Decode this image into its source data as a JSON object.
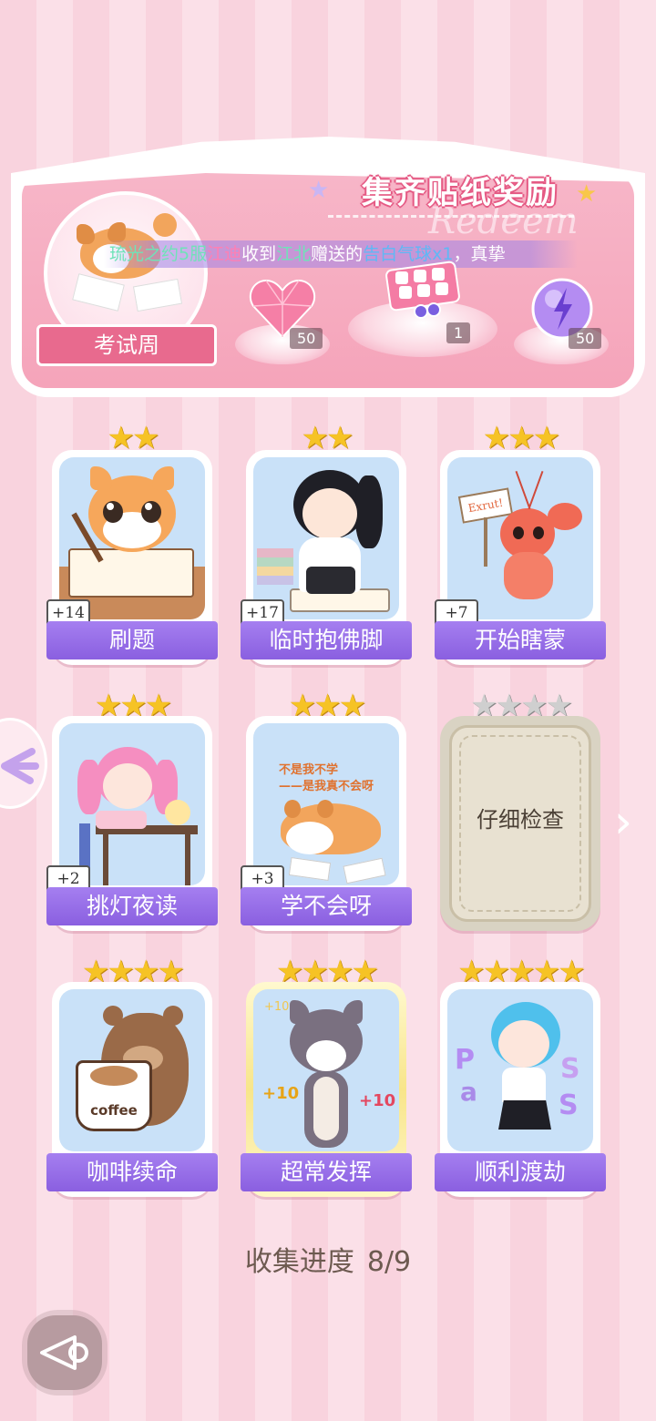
{
  "banner": {
    "title": "集齐贴纸奖励",
    "theme_label": "考试周",
    "marquee": {
      "part1": "琉光之约5服",
      "part2": "江迪",
      "part3": "收到",
      "part4": "江北",
      "part5": "赠送的",
      "part6": "告白气球x1",
      "part7": "，真挚"
    },
    "rewards": [
      {
        "name": "heart-gem",
        "count": "50"
      },
      {
        "name": "gift-box",
        "count": "1"
      },
      {
        "name": "energy-orb",
        "count": "50"
      }
    ]
  },
  "cards": [
    {
      "label": "刷题",
      "count": "+14",
      "stars": "★★",
      "locked": false
    },
    {
      "label": "临时抱佛脚",
      "count": "+17",
      "stars": "★★",
      "locked": false
    },
    {
      "label": "开始瞎蒙",
      "count": "+7",
      "stars": "★★★",
      "locked": false
    },
    {
      "label": "挑灯夜读",
      "count": "+2",
      "stars": "★★★",
      "locked": false
    },
    {
      "label": "学不会呀",
      "count": "+3",
      "stars": "★★★",
      "locked": false
    },
    {
      "label": "仔细检查",
      "count": "",
      "stars": "★★★★",
      "locked": true
    },
    {
      "label": "咖啡续命",
      "count": "",
      "stars": "★★★★",
      "locked": false
    },
    {
      "label": "超常发挥",
      "count": "",
      "stars": "★★★★",
      "locked": false
    },
    {
      "label": "顺利渡劫",
      "count": "",
      "stars": "★★★★★",
      "locked": false
    }
  ],
  "art_text": {
    "sign": "Exrut!",
    "shiba_caption_1": "不是我不学",
    "shiba_caption_2": "——是我真不会呀",
    "coffee_cup": "coffee",
    "plus_ten": "+10"
  },
  "progress": {
    "label": "收集进度",
    "value": "8/9"
  }
}
